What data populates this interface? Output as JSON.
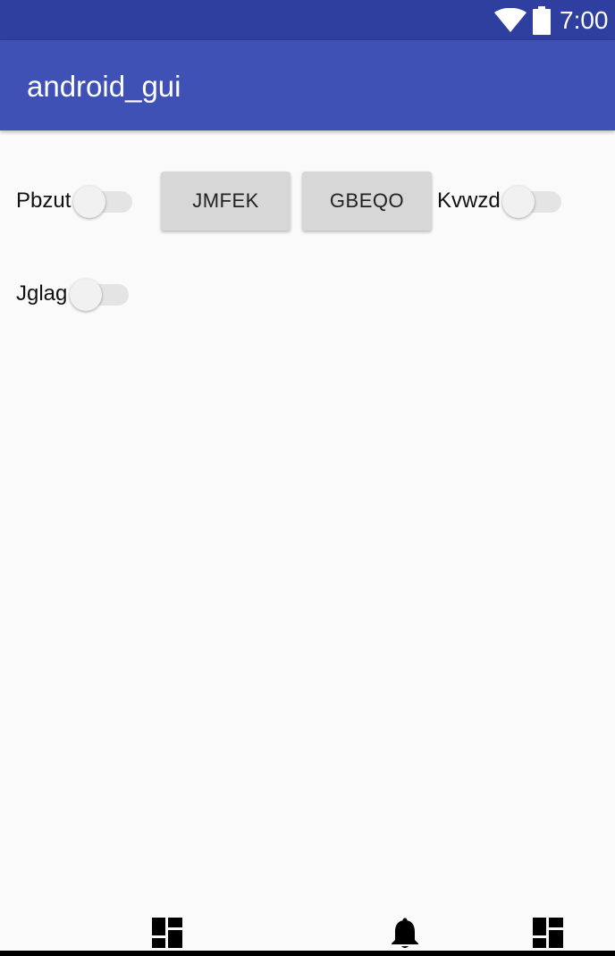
{
  "status_bar": {
    "time": "7:00",
    "icons": [
      "wifi-icon",
      "battery-icon"
    ],
    "background": "#2f3f9f"
  },
  "app_bar": {
    "title": "android_gui",
    "background": "#3f51b5"
  },
  "switches": [
    {
      "label": "Pbzut",
      "checked": false
    },
    {
      "label": "Kvwzd",
      "checked": false
    },
    {
      "label": "Jglag",
      "checked": false
    }
  ],
  "buttons": [
    {
      "label": "JMFEK"
    },
    {
      "label": "GBEQO"
    }
  ],
  "bottom_nav": {
    "icons": [
      "dashboard-icon",
      "notification-bell-icon",
      "dashboard-icon"
    ]
  }
}
